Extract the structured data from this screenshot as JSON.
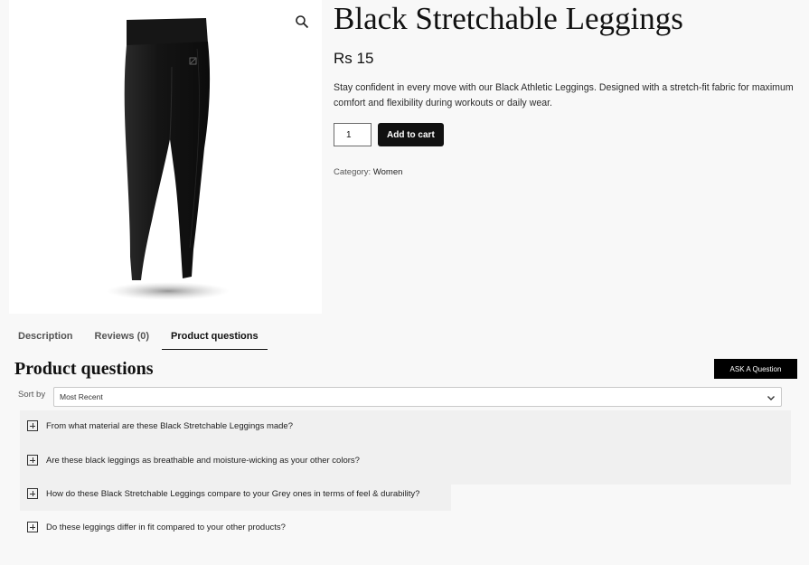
{
  "product": {
    "title": "Black Stretchable Leggings",
    "price": "Rs 15",
    "short_description": "Stay confident in every move with our Black Athletic Leggings. Designed with a stretch-fit fabric for maximum comfort and flexibility during workouts or daily wear.",
    "quantity": "1",
    "add_to_cart_label": "Add to cart",
    "category_label": "Category:",
    "category_value": "Women",
    "zoom_icon": "search-icon"
  },
  "tabs": [
    {
      "label": "Description",
      "active": false
    },
    {
      "label": "Reviews (0)",
      "active": false
    },
    {
      "label": "Product questions",
      "active": true
    }
  ],
  "questions_section": {
    "title": "Product questions",
    "ask_button_label": "ASK A Question",
    "sort_label": "Sort by",
    "sort_selected": "Most Recent",
    "questions": [
      "From what material are these Black Stretchable Leggings made?",
      "Are these black leggings as breathable and moisture-wicking as your other colors?",
      "How do these Black Stretchable Leggings compare to your Grey ones in terms of feel & durability?",
      "Do these leggings differ in fit compared to your other products?"
    ]
  },
  "colors": {
    "page_bg": "#f8f8f8",
    "button_bg": "#111111",
    "text": "#1d1d1d"
  }
}
